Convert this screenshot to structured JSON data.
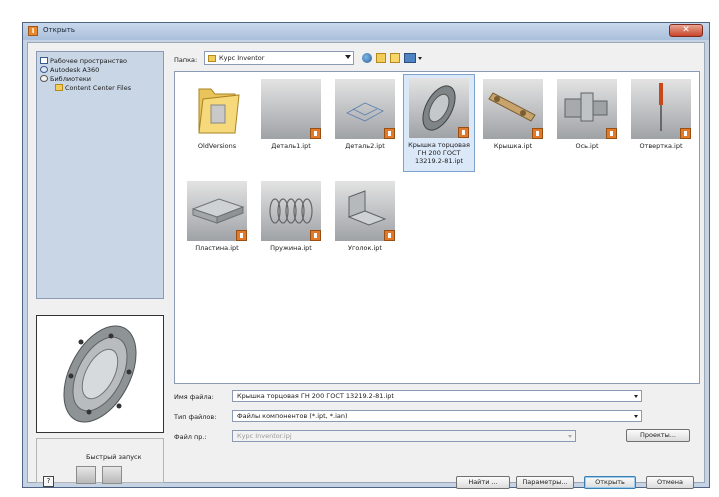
{
  "window": {
    "title": "Открыть",
    "app_icon": "inventor-icon",
    "close_icon": "close-icon"
  },
  "tree": {
    "items": [
      {
        "label": "Рабочее пространство",
        "icon": "workspace-icon"
      },
      {
        "label": "Autodesk A360",
        "icon": "globe-icon"
      },
      {
        "label": "Библиотеки",
        "icon": "library-icon"
      },
      {
        "label": "Content Center Files",
        "icon": "folder-icon"
      }
    ]
  },
  "toolbar": {
    "folder_label": "Папка:",
    "folder_value": "Курс Inventor"
  },
  "files": [
    {
      "name": "OldVersions",
      "kind": "folder"
    },
    {
      "name": "Деталь1.ipt",
      "kind": "part"
    },
    {
      "name": "Деталь2.ipt",
      "kind": "part"
    },
    {
      "name": "Крышка торцовая ГН 200 ГОСТ 13219.2-81.ipt",
      "kind": "part",
      "selected": true
    },
    {
      "name": "Крышка.ipt",
      "kind": "part"
    },
    {
      "name": "Ось.ipt",
      "kind": "part"
    },
    {
      "name": "Отвертка.ipt",
      "kind": "part"
    },
    {
      "name": "Пластина.ipt",
      "kind": "part"
    },
    {
      "name": "Пружина.ipt",
      "kind": "part"
    },
    {
      "name": "Уголок.ipt",
      "kind": "part"
    }
  ],
  "form": {
    "filename_label": "Имя файла:",
    "filename_value": "Крышка торцовая ГН 200 ГОСТ 13219.2-81.ipt",
    "filetype_label": "Тип файлов:",
    "filetype_value": "Файлы компонентов (*.ipt, *.ian)",
    "project_label": "Файл пр.:",
    "project_value": "Курс Inventor.ipj",
    "projects_button": "Проекты..."
  },
  "quick_launch": {
    "label": "Быстрый запуск"
  },
  "buttons": {
    "find": "Найти ...",
    "options": "Параметры...",
    "open": "Открыть",
    "cancel": "Отмена",
    "help": "?"
  },
  "colors": {
    "frame": "#c5d3e4",
    "tree_bg": "#c9d6e6",
    "badge": "#e07a2a",
    "selection": "#dbe8f7"
  }
}
